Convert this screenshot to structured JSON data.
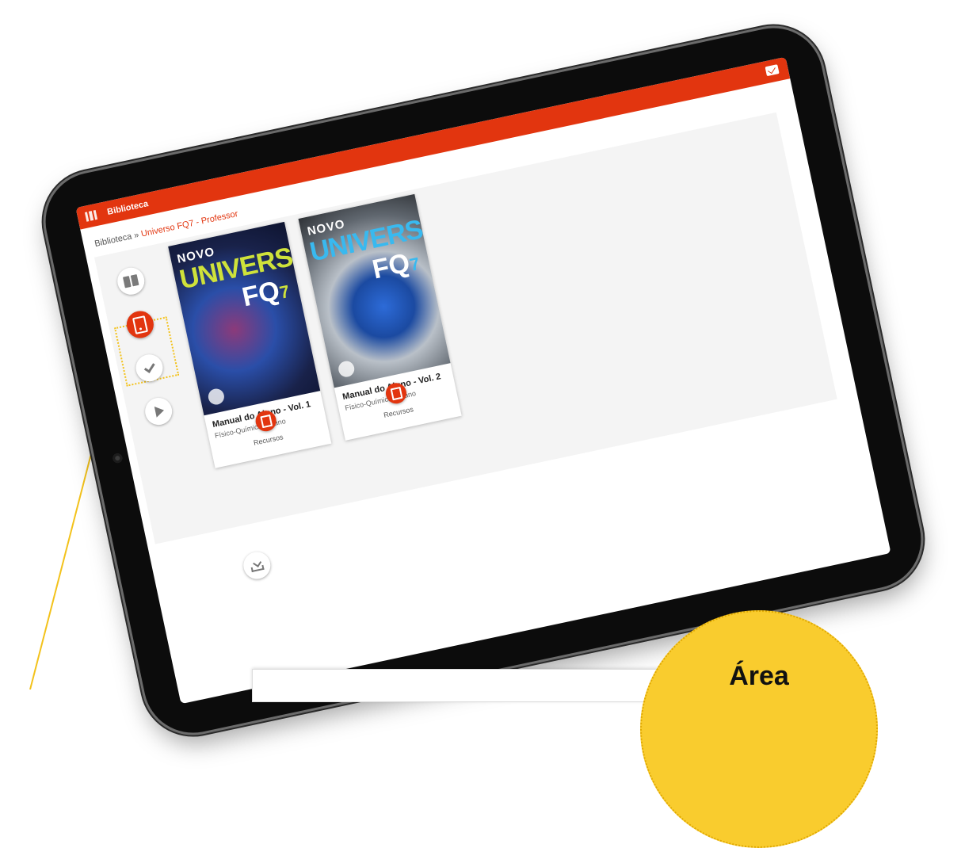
{
  "app": {
    "topbar_title": "Biblioteca"
  },
  "breadcrumb": {
    "root": "Biblioteca",
    "separator": " » ",
    "current": "Universo FQ7 - Professor"
  },
  "side_nav": {
    "items": [
      {
        "name": "manuals",
        "icon": "book-icon",
        "active": false
      },
      {
        "name": "digital",
        "icon": "tablet-icon",
        "active": true
      },
      {
        "name": "exercises",
        "icon": "check-icon",
        "active": false
      },
      {
        "name": "videos",
        "icon": "play-icon",
        "active": false
      }
    ],
    "download_icon": "download-icon"
  },
  "books": [
    {
      "cover_prefix": "NOVO",
      "cover_title": "UNIVERSO",
      "cover_fq": "FQ",
      "cover_grade": "7",
      "title": "Manual do Aluno - Vol. 1",
      "subtitle": "Físico-Química 7.º ano",
      "action_label": "Recursos"
    },
    {
      "cover_prefix": "NOVO",
      "cover_title": "UNIVERSO",
      "cover_fq": "FQ",
      "cover_grade": "7",
      "title": "Manual do Aluno - Vol. 2",
      "subtitle": "Físico-Química 7.º ano",
      "action_label": "Recursos"
    }
  ],
  "callout": {
    "text": "Área"
  },
  "colors": {
    "brand": "#e2350f",
    "highlight": "#f9cc2e"
  }
}
